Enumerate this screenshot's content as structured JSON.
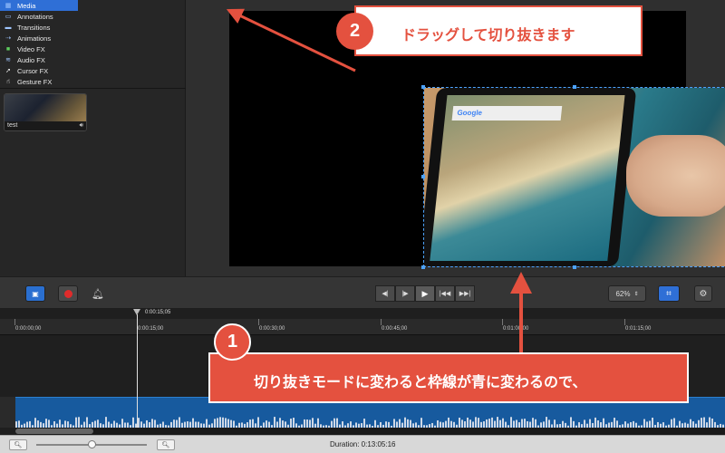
{
  "sidebar": {
    "items": [
      {
        "label": "Media",
        "icon": "film-icon",
        "selected": true
      },
      {
        "label": "Annotations",
        "icon": "annotation-icon"
      },
      {
        "label": "Transitions",
        "icon": "transition-icon"
      },
      {
        "label": "Animations",
        "icon": "animation-icon"
      },
      {
        "label": "Video FX",
        "icon": "video-fx-icon"
      },
      {
        "label": "Audio FX",
        "icon": "audio-fx-icon"
      },
      {
        "label": "Cursor FX",
        "icon": "cursor-icon"
      },
      {
        "label": "Gesture FX",
        "icon": "hand-icon"
      }
    ],
    "media_clip": {
      "name": "test",
      "icon": "speaker-icon"
    }
  },
  "canvas": {
    "search_brand": "Google",
    "selection_color": "#4da3ff"
  },
  "toolbar": {
    "zoom": "62%",
    "transport_icons": [
      "step-back-icon",
      "frame-back-icon",
      "play-icon",
      "skip-start-icon",
      "skip-end-icon"
    ]
  },
  "timeline": {
    "playhead": "0:00:15;05",
    "ticks": [
      "0:00:00;00",
      "0:00:15;00",
      "0:00:30;00",
      "0:00:45;00",
      "0:01:00;00",
      "0:01:15;00"
    ],
    "track_color": "#175a9e"
  },
  "statusbar": {
    "duration": "Duration: 0:13:05:16",
    "zoom_level": 0.78
  },
  "annotations": {
    "step1": {
      "number": "1",
      "text": "切り抜きモードに変わると枠線が青に変わるので、"
    },
    "step2": {
      "number": "2",
      "text": "ドラッグして切り抜きます"
    },
    "accent": "#e4513f"
  }
}
